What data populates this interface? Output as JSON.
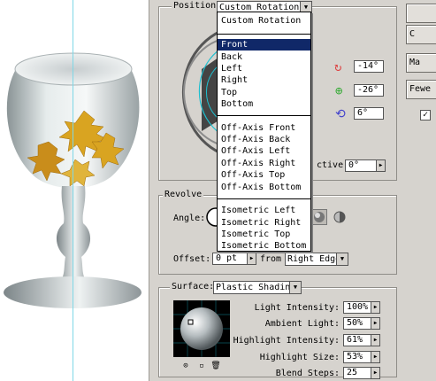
{
  "position": {
    "label": "Position:",
    "selected": "Custom Rotation",
    "options": [
      "Custom Rotation",
      "Front",
      "Back",
      "Left",
      "Right",
      "Top",
      "Bottom",
      "Off-Axis Front",
      "Off-Axis Back",
      "Off-Axis Left",
      "Off-Axis Right",
      "Off-Axis Top",
      "Off-Axis Bottom",
      "Isometric Left",
      "Isometric Right",
      "Isometric Top",
      "Isometric Bottom"
    ],
    "highlighted": "Front"
  },
  "rotation": {
    "x": "-14°",
    "y": "-26°",
    "z": "6°",
    "perspective_label": "ctive:",
    "perspective_value": "0°"
  },
  "revolve": {
    "title": "Revolve",
    "angle_label": "Angle:",
    "offset_label": "Offset:",
    "offset_value": "0 pt",
    "from_label": "from",
    "from_value": "Right Edge"
  },
  "surface": {
    "label": "Surface:",
    "value": "Plastic Shading",
    "light_intensity_label": "Light Intensity:",
    "light_intensity": "100%",
    "ambient_light_label": "Ambient Light:",
    "ambient_light": "50%",
    "highlight_intensity_label": "Highlight Intensity:",
    "highlight_intensity": "61%",
    "highlight_size_label": "Highlight Size:",
    "highlight_size": "53%",
    "blend_steps_label": "Blend Steps:",
    "blend_steps": "25"
  },
  "side_buttons": {
    "b1": "",
    "b2": "C",
    "b3": "Ma",
    "b4": "Fewe",
    "checkbox": "✓"
  },
  "icons": {
    "rotate_x": "rotate-x-icon",
    "rotate_y": "rotate-y-icon",
    "rotate_z": "rotate-z-icon"
  },
  "colors": {
    "panel_bg": "#d6d3ce",
    "menu_highlight": "#102868",
    "x_axis": "#d44",
    "y_axis": "#3a3",
    "z_axis": "#44c"
  }
}
